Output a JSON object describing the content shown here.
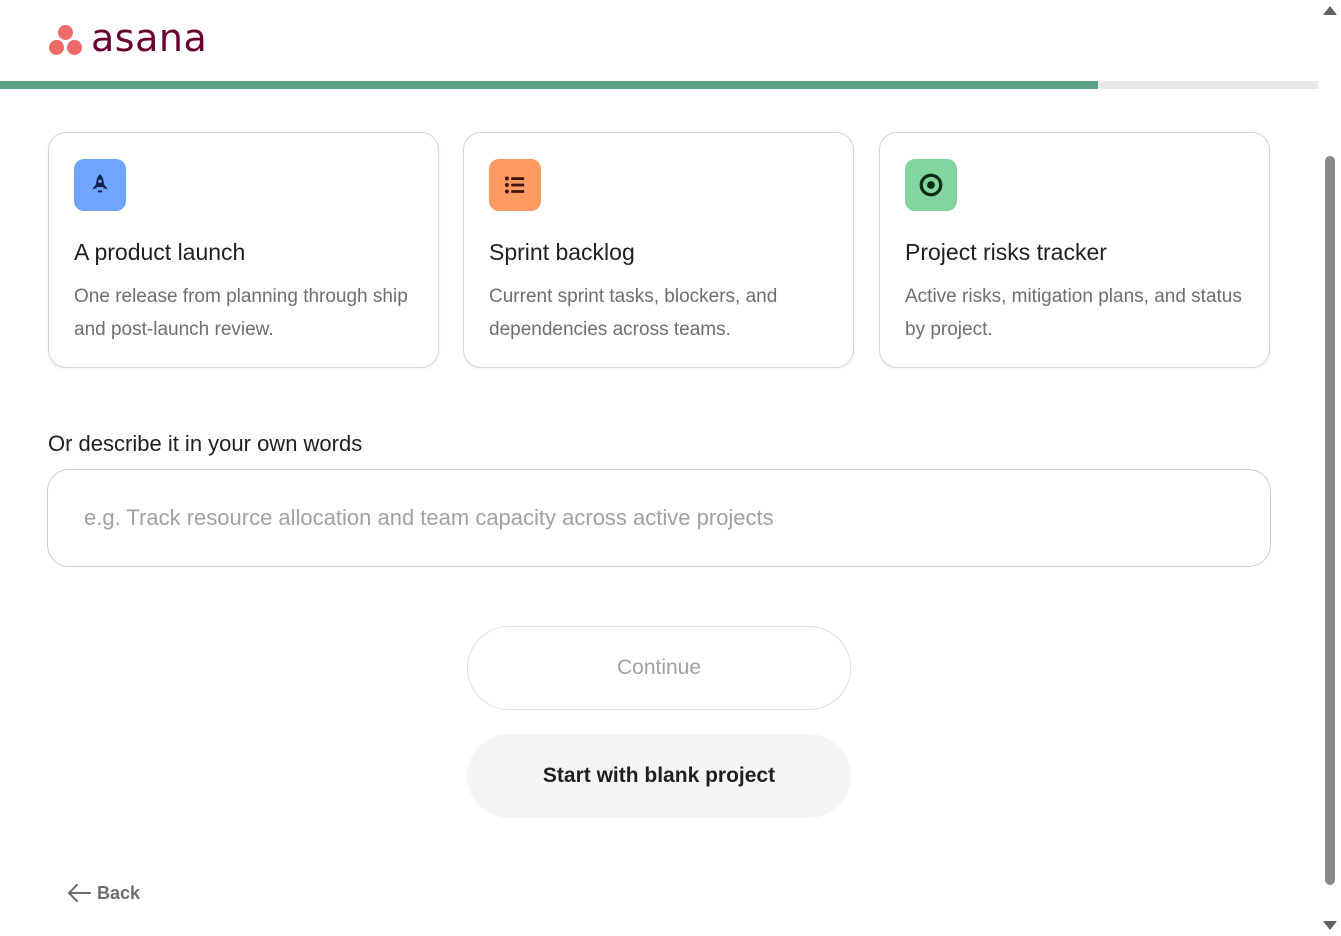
{
  "brand": {
    "name": "asana",
    "dot_color": "#f06a6a",
    "word_color": "#690031"
  },
  "progress": {
    "fraction": 0.833,
    "fill_color": "#5da283"
  },
  "templates": [
    {
      "icon": "rocket-icon",
      "icon_bg": "#6fa4ff",
      "title": "A product launch",
      "description": "One release from planning through ship and post-launch review."
    },
    {
      "icon": "list-icon",
      "icon_bg": "#fd9a62",
      "title": "Sprint backlog",
      "description": "Current sprint tasks, blockers, and dependencies across teams."
    },
    {
      "icon": "target-icon",
      "icon_bg": "#83d5a0",
      "title": "Project risks tracker",
      "description": "Active risks, mitigation plans, and status by project."
    }
  ],
  "custom": {
    "label": "Or describe it in your own words",
    "placeholder": "e.g. Track resource allocation and team capacity across active projects",
    "value": ""
  },
  "actions": {
    "continue_label": "Continue",
    "blank_label": "Start with blank project",
    "back_label": "Back"
  }
}
